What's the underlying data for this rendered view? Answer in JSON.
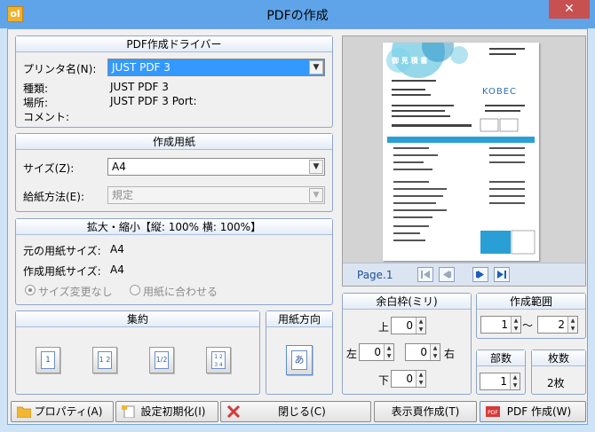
{
  "window": {
    "title": "PDFの作成",
    "close_glyph": "✕"
  },
  "driver": {
    "heading": "PDF作成ドライバー",
    "printer_label": "プリンタ名(N):",
    "printer_value": "JUST PDF 3",
    "type_label": "種類:",
    "type_value": "JUST PDF 3",
    "location_label": "場所:",
    "location_value": "JUST PDF 3 Port:",
    "comment_label": "コメント:",
    "comment_value": ""
  },
  "paper": {
    "heading": "作成用紙",
    "size_label": "サイズ(Z):",
    "size_value": "A4",
    "feed_label": "給紙方法(E):",
    "feed_value": "規定"
  },
  "scale": {
    "heading": "拡大・縮小【縦: 100% 横: 100%】",
    "original_label": "元の用紙サイズ:",
    "original_value": "A4",
    "created_label": "作成用紙サイズ:",
    "created_value": "A4",
    "radio_nochange": "サイズ変更なし",
    "radio_fit": "用紙に合わせる"
  },
  "nup": {
    "heading": "集約",
    "tiles": [
      "1",
      "1 2",
      "1/2",
      "1 2 3 4"
    ]
  },
  "orientation": {
    "heading": "用紙方向",
    "glyph": "あ"
  },
  "preview": {
    "page_label": "Page.1",
    "doc_title": "御 見 積 書",
    "logo": "KOBEC",
    "nav_colors": {
      "disabled": "#9aa8bb",
      "active": "#1f5fb5"
    }
  },
  "margins": {
    "heading": "余白枠(ミリ)",
    "top_label": "上",
    "top": "0",
    "left_label": "左",
    "left": "0",
    "right_label": "右",
    "right": "0",
    "bottom_label": "下",
    "bottom": "0"
  },
  "range": {
    "heading": "作成範囲",
    "from": "1",
    "sep": "〜",
    "to": "2"
  },
  "copies": {
    "heading": "部数",
    "value": "1"
  },
  "sheets": {
    "heading": "枚数",
    "value": "2枚"
  },
  "buttons": {
    "properties": "プロパティ(A)",
    "reset": "設定初期化(I)",
    "close": "閉じる(C)",
    "create_displayed": "表示頁作成(T)",
    "create_pdf": "PDF 作成(W)"
  },
  "colors": {
    "title_bar": "#5fa4e8",
    "accent_blue": "#1f5fb5",
    "pdf_red": "#d43a3a"
  }
}
